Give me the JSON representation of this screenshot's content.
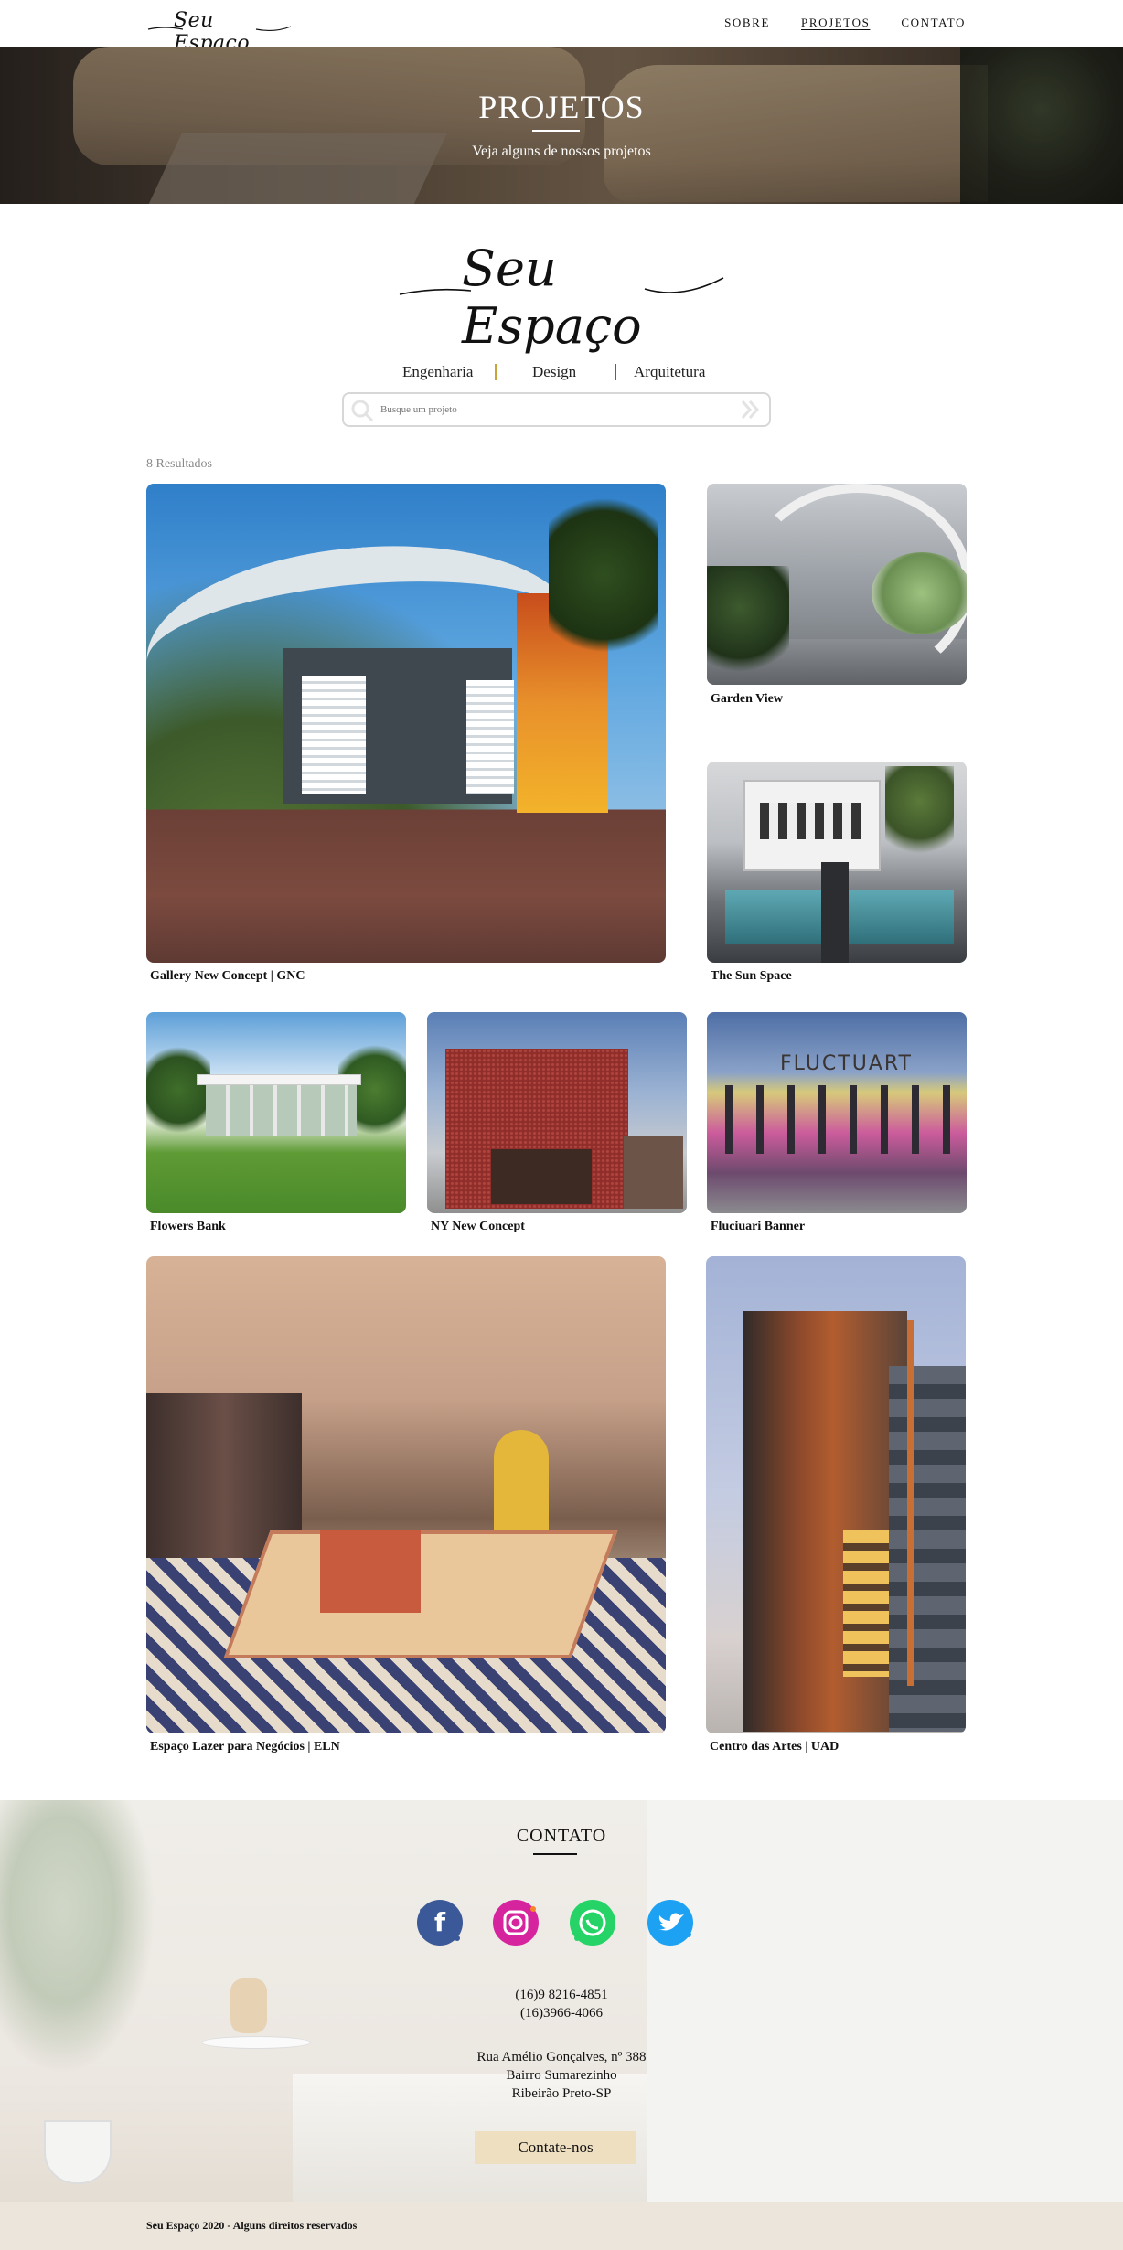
{
  "nav": {
    "logo": "Seu Espaço",
    "items": [
      {
        "label": "SOBRE",
        "active": false
      },
      {
        "label": "PROJETOS",
        "active": true
      },
      {
        "label": "CONTATO",
        "active": false
      }
    ]
  },
  "hero": {
    "title": "PROJETOS",
    "subtitle": "Veja alguns de nossos projetos"
  },
  "brand": {
    "logo": "Seu Espaço"
  },
  "filters": [
    {
      "label": "Engenharia",
      "separator_color": "#c9a43a"
    },
    {
      "label": "Design",
      "separator_color": "#8a3ab9"
    },
    {
      "label": "Arquitetura"
    }
  ],
  "search": {
    "placeholder": "Busque um projeto",
    "value": ""
  },
  "results": {
    "label": "8 Resultados"
  },
  "projects": [
    {
      "name": "Gallery New Concept | GNC"
    },
    {
      "name": "Garden View"
    },
    {
      "name": "The Sun Space"
    },
    {
      "name": "Flowers Bank"
    },
    {
      "name": "NY New Concept"
    },
    {
      "name": "Fluciuari Banner"
    },
    {
      "name": "Espaço Lazer para Negócios | ELN"
    },
    {
      "name": "Centro das Artes | UAD"
    }
  ],
  "contact": {
    "title": "CONTATO",
    "social": [
      {
        "icon": "facebook-icon",
        "color": "#3b5998"
      },
      {
        "icon": "instagram-icon",
        "color": "#d6249f"
      },
      {
        "icon": "whatsapp-icon",
        "color": "#25d366"
      },
      {
        "icon": "twitter-icon",
        "color": "#1da1f2"
      }
    ],
    "phones": [
      "(16)9 8216-4851",
      "(16)3966-4066"
    ],
    "address": [
      "Rua Amélio Gonçalves, nº 388",
      "Bairro Sumarezinho",
      "Ribeirão Preto-SP"
    ],
    "cta": "Contate-nos"
  },
  "footer": {
    "text": "Seu Espaço 2020 - Alguns direitos reservados"
  }
}
